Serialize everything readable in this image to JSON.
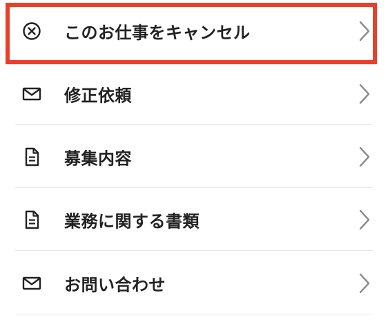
{
  "menu": {
    "items": [
      {
        "label": "このお仕事をキャンセル",
        "icon": "cancel-circle-icon"
      },
      {
        "label": "修正依頼",
        "icon": "mail-icon"
      },
      {
        "label": "募集内容",
        "icon": "document-icon"
      },
      {
        "label": "業務に関する書類",
        "icon": "document-icon"
      },
      {
        "label": "お問い合わせ",
        "icon": "mail-icon"
      }
    ],
    "highlight_color": "#e8402a"
  }
}
